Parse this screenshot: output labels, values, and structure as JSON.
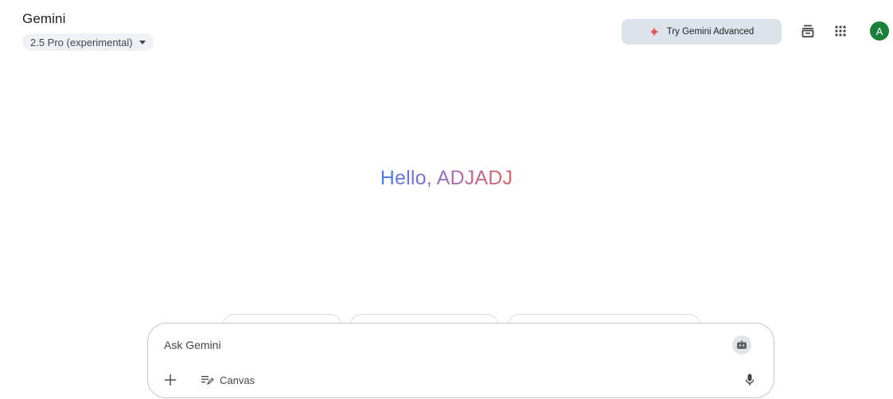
{
  "header": {
    "app_title": "Gemini",
    "model_label": "2.5 Pro (experimental)",
    "try_advanced_label": "Try Gemini Advanced",
    "avatar_initial": "A"
  },
  "greeting": {
    "text": "Hello, ADJADJ"
  },
  "input": {
    "placeholder": "Ask Gemini",
    "canvas_label": "Canvas"
  },
  "colors": {
    "spark": "#e0574f",
    "avatar_bg": "#188038",
    "advanced_button_bg": "#dde3ea",
    "model_picker_bg": "#eef1f6",
    "greeting_gradient": [
      "#4b7ee8",
      "#7d6fd6",
      "#b56aa9",
      "#d9625f"
    ]
  },
  "icons": {
    "spark": "spark-icon",
    "library": "library-icon",
    "apps": "apps-grid-icon",
    "bot": "bot-icon",
    "plus": "plus-icon",
    "canvas": "canvas-icon",
    "mic": "mic-icon",
    "caret": "caret-down-icon"
  }
}
